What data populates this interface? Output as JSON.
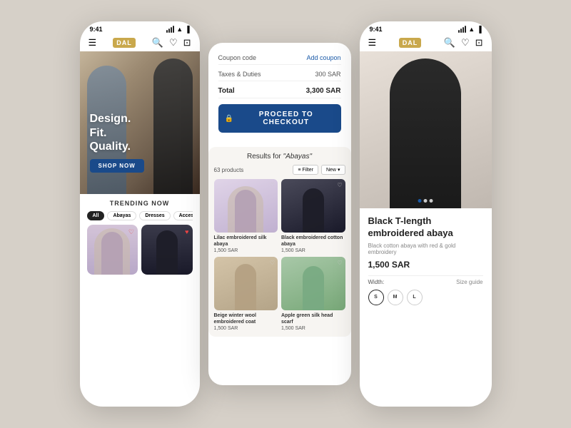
{
  "background_color": "#d6d0c8",
  "phones": {
    "left": {
      "status_time": "9:41",
      "logo": "DAL",
      "hero": {
        "line1": "Design.",
        "line2": "Fit.",
        "line3": "Quality.",
        "cta_label": "SHOP NOW"
      },
      "trending": {
        "title": "TRENDING NOW",
        "pills": [
          "All",
          "Abayas",
          "Dresses",
          "Accessories"
        ],
        "active_pill": "All"
      }
    },
    "middle": {
      "cart": {
        "coupon_label": "Coupon code",
        "add_coupon_label": "Add coupon",
        "taxes_label": "Taxes & Duties",
        "taxes_value": "300 SAR",
        "total_label": "Total",
        "total_value": "3,300 SAR",
        "proceed_label": "PROCEED TO CHECKOUT"
      },
      "search": {
        "query": "Abayas",
        "results_prefix": "Results for",
        "count": "63 products",
        "filter_label": "Filter",
        "sort_label": "New",
        "products": [
          {
            "name": "Lilac embroidered silk abaya",
            "price": "1,500 SAR",
            "img_class": "prod-lilac"
          },
          {
            "name": "Black embroidered cotton abaya",
            "price": "1,500 SAR",
            "img_class": "prod-black"
          },
          {
            "name": "Beige winter wool embroidered coat",
            "price": "1,500 SAR",
            "img_class": "prod-beige"
          },
          {
            "name": "Apple green silk head scarf",
            "price": "1,500 SAR",
            "img_class": "prod-green"
          }
        ]
      }
    },
    "right": {
      "status_time": "9:41",
      "logo": "DAL",
      "product": {
        "name": "Black T-length embroidered abaya",
        "description": "Black cotton abaya with red & gold embroidery",
        "price": "1,500 SAR",
        "width_label": "Width:",
        "size_guide_label": "Size guide",
        "sizes": [
          "S",
          "M",
          "L"
        ]
      }
    }
  }
}
